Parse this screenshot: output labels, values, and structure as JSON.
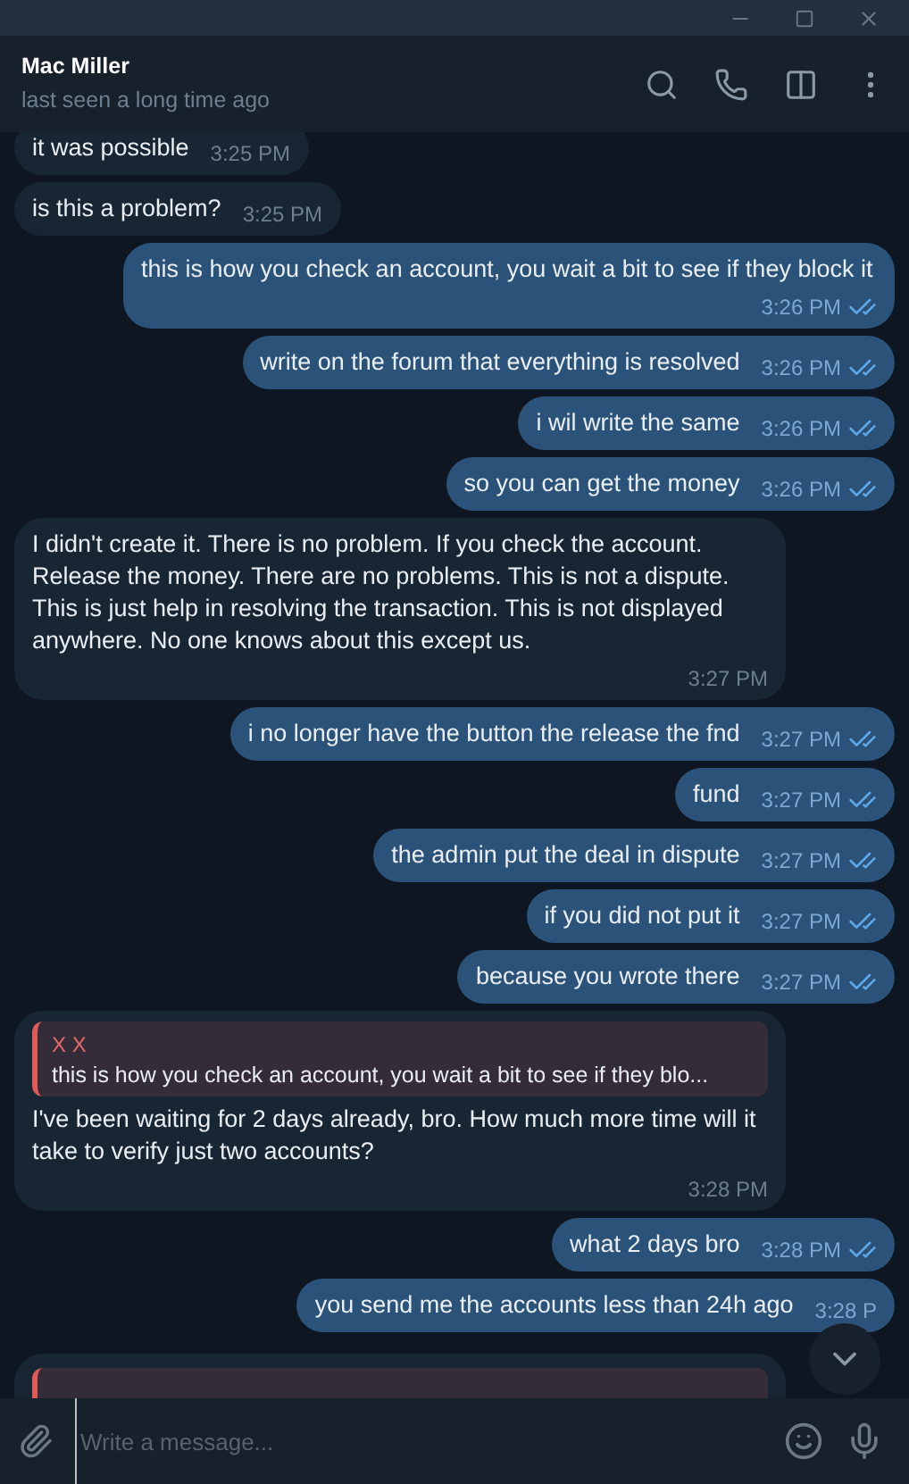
{
  "chat": {
    "name": "Mac Miller",
    "status": "last seen a long time ago"
  },
  "messages": [
    {
      "kind": "text",
      "outgoing": false,
      "text": "it was possible",
      "time": "3:25 PM"
    },
    {
      "kind": "text",
      "outgoing": false,
      "text": "is this a problem?",
      "time": "3:25 PM"
    },
    {
      "kind": "text",
      "outgoing": true,
      "read": true,
      "text": "this is how you check an account, you wait a bit to see if they block it",
      "time": "3:26 PM"
    },
    {
      "kind": "text",
      "outgoing": true,
      "read": true,
      "text": "write on the forum that everything is resolved",
      "time": "3:26 PM"
    },
    {
      "kind": "text",
      "outgoing": true,
      "read": true,
      "text": "i wil write the same",
      "time": "3:26 PM"
    },
    {
      "kind": "text",
      "outgoing": true,
      "read": true,
      "text": "so you can get the money",
      "time": "3:26 PM"
    },
    {
      "kind": "text",
      "outgoing": false,
      "text": "I didn't create it. There is no problem. If you check the account. Release the money. There are no problems. This is not a dispute. This is just help in resolving the transaction. This is not displayed anywhere. No one knows about this except us.",
      "time": "3:27 PM"
    },
    {
      "kind": "text",
      "outgoing": true,
      "read": true,
      "text": "i no longer have the button the release the fnd",
      "time": "3:27 PM"
    },
    {
      "kind": "text",
      "outgoing": true,
      "read": true,
      "text": "fund",
      "time": "3:27 PM"
    },
    {
      "kind": "text",
      "outgoing": true,
      "read": true,
      "text": "the admin put the deal in dispute",
      "time": "3:27 PM"
    },
    {
      "kind": "text",
      "outgoing": true,
      "read": true,
      "text": "if you did not put it",
      "time": "3:27 PM"
    },
    {
      "kind": "text",
      "outgoing": true,
      "read": true,
      "text": "because you wrote there",
      "time": "3:27 PM"
    },
    {
      "kind": "reply",
      "outgoing": false,
      "reply_author": "X X",
      "reply_text": "this is how you check an account, you wait a bit to see if they blo...",
      "text": "I've been waiting for 2 days already, bro. How much more time will it take to verify just two accounts?",
      "time": "3:28 PM"
    },
    {
      "kind": "text",
      "outgoing": true,
      "read": true,
      "text": "what 2 days bro",
      "time": "3:28 PM"
    },
    {
      "kind": "text",
      "outgoing": true,
      "text": "you send me the accounts less than 24h ago",
      "time": "3:28 P"
    }
  ],
  "composer": {
    "placeholder": "Write a message..."
  }
}
